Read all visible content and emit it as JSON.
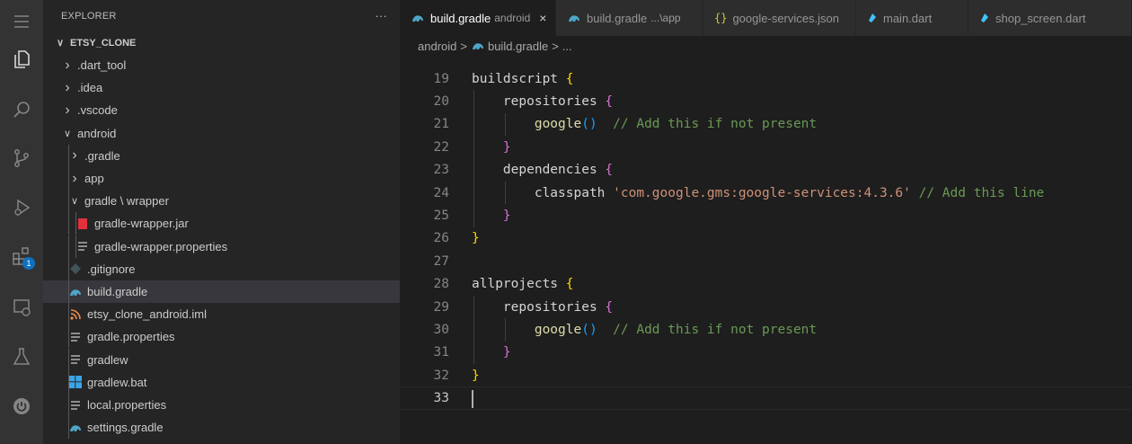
{
  "activity_bar": {
    "items": [
      {
        "icon": "files-icon"
      },
      {
        "icon": "search-icon"
      },
      {
        "icon": "source-control-icon"
      },
      {
        "icon": "run-debug-icon"
      },
      {
        "icon": "extensions-icon",
        "badge": "1"
      },
      {
        "icon": "remote-explorer-icon"
      },
      {
        "icon": "testing-icon"
      },
      {
        "icon": "power-icon"
      }
    ]
  },
  "sidebar": {
    "title": "EXPLORER",
    "more": "···",
    "project": "ETSY_CLONE",
    "tree": [
      {
        "label": ".dart_tool",
        "type": "folder",
        "depth": 1,
        "expanded": false
      },
      {
        "label": ".idea",
        "type": "folder",
        "depth": 1,
        "expanded": false
      },
      {
        "label": ".vscode",
        "type": "folder",
        "depth": 1,
        "expanded": false
      },
      {
        "label": "android",
        "type": "folder",
        "depth": 1,
        "expanded": true
      },
      {
        "label": ".gradle",
        "type": "folder",
        "depth": 2,
        "expanded": false
      },
      {
        "label": "app",
        "type": "folder",
        "depth": 2,
        "expanded": false
      },
      {
        "label": "gradle \\ wrapper",
        "type": "folder",
        "depth": 2,
        "expanded": true
      },
      {
        "label": "gradle-wrapper.jar",
        "type": "file",
        "depth": 3,
        "icon": "jar-icon"
      },
      {
        "label": "gradle-wrapper.properties",
        "type": "file",
        "depth": 3,
        "icon": "properties-icon"
      },
      {
        "label": ".gitignore",
        "type": "file",
        "depth": 2,
        "icon": "git-icon"
      },
      {
        "label": "build.gradle",
        "type": "file",
        "depth": 2,
        "icon": "gradle-icon",
        "selected": true
      },
      {
        "label": "etsy_clone_android.iml",
        "type": "file",
        "depth": 2,
        "icon": "rss-icon"
      },
      {
        "label": "gradle.properties",
        "type": "file",
        "depth": 2,
        "icon": "properties-icon"
      },
      {
        "label": "gradlew",
        "type": "file",
        "depth": 2,
        "icon": "properties-icon"
      },
      {
        "label": "gradlew.bat",
        "type": "file",
        "depth": 2,
        "icon": "windows-icon"
      },
      {
        "label": "local.properties",
        "type": "file",
        "depth": 2,
        "icon": "properties-icon"
      },
      {
        "label": "settings.gradle",
        "type": "file",
        "depth": 2,
        "icon": "gradle-icon"
      }
    ]
  },
  "tabs": [
    {
      "label": "build.gradle",
      "sub": "android",
      "active": true,
      "close": "×",
      "icon": "gradle-icon"
    },
    {
      "label": "build.gradle",
      "sub": "...\\app",
      "active": false,
      "icon": "gradle-icon"
    },
    {
      "label": "google-services.json",
      "sub": "",
      "active": false,
      "icon": "json-icon"
    },
    {
      "label": "main.dart",
      "sub": "",
      "active": false,
      "icon": "dart-icon"
    },
    {
      "label": "shop_screen.dart",
      "sub": "",
      "active": false,
      "icon": "dart-icon"
    }
  ],
  "breadcrumb": {
    "parts": [
      "android",
      "build.gradle",
      "..."
    ],
    "separator": ">"
  },
  "code": {
    "lines": [
      {
        "n": "19",
        "tokens": [
          [
            "id",
            "buildscript "
          ],
          [
            "b1",
            "{"
          ]
        ]
      },
      {
        "n": "20",
        "tokens": [
          [
            "id",
            "    repositories "
          ],
          [
            "b2",
            "{"
          ]
        ]
      },
      {
        "n": "21",
        "tokens": [
          [
            "id",
            "        "
          ],
          [
            "fn",
            "google"
          ],
          [
            "b3",
            "()"
          ],
          [
            "com",
            "  // Add this if not present"
          ]
        ]
      },
      {
        "n": "22",
        "tokens": [
          [
            "id",
            "    "
          ],
          [
            "b2",
            "}"
          ]
        ]
      },
      {
        "n": "23",
        "tokens": [
          [
            "id",
            "    dependencies "
          ],
          [
            "b2",
            "{"
          ]
        ]
      },
      {
        "n": "24",
        "tokens": [
          [
            "id",
            "        classpath "
          ],
          [
            "str",
            "'com.google.gms:google-services:4.3.6'"
          ],
          [
            "com",
            " // Add this line"
          ]
        ]
      },
      {
        "n": "25",
        "tokens": [
          [
            "id",
            "    "
          ],
          [
            "b2",
            "}"
          ]
        ]
      },
      {
        "n": "26",
        "tokens": [
          [
            "b1",
            "}"
          ]
        ]
      },
      {
        "n": "27",
        "tokens": []
      },
      {
        "n": "28",
        "tokens": [
          [
            "id",
            "allprojects "
          ],
          [
            "b1",
            "{"
          ]
        ]
      },
      {
        "n": "29",
        "tokens": [
          [
            "id",
            "    repositories "
          ],
          [
            "b2",
            "{"
          ]
        ]
      },
      {
        "n": "30",
        "tokens": [
          [
            "id",
            "        "
          ],
          [
            "fn",
            "google"
          ],
          [
            "b3",
            "()"
          ],
          [
            "com",
            "  // Add this if not present"
          ]
        ]
      },
      {
        "n": "31",
        "tokens": [
          [
            "id",
            "    "
          ],
          [
            "b2",
            "}"
          ]
        ]
      },
      {
        "n": "32",
        "tokens": [
          [
            "b1",
            "}"
          ]
        ]
      },
      {
        "n": "33",
        "tokens": [],
        "current": true
      }
    ]
  },
  "colors": {
    "background": "#1e1e1e",
    "sidebar": "#252526",
    "activity_bar": "#333333",
    "selected_row": "#37373d",
    "function": "#dcdcaa",
    "string": "#ce9178",
    "comment": "#6a9955",
    "bracket1": "#ffd700",
    "bracket2": "#da70d6",
    "bracket3": "#179fff"
  }
}
